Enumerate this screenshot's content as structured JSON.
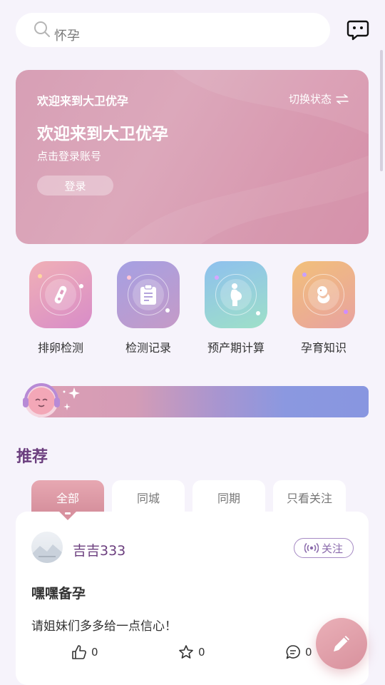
{
  "search": {
    "text": "怀孕",
    "icon": "search-icon"
  },
  "header": {
    "message_icon": "message-icon"
  },
  "banner": {
    "welcome_small": "欢迎来到大卫优孕",
    "switch_label": "切换状态",
    "switch_icon": "swap-icon",
    "welcome_big": "欢迎来到大卫优孕",
    "login_hint": "点击登录账号",
    "login_button": "登录"
  },
  "tools": [
    {
      "label": "排卵检测",
      "icon": "ovulation-test-icon",
      "color_from": "#f0b0b6",
      "color_to": "#d88cc8"
    },
    {
      "label": "检测记录",
      "icon": "clipboard-icon",
      "color_from": "#a5a0e3",
      "color_to": "#c59ac7"
    },
    {
      "label": "预产期计算",
      "icon": "pregnant-woman-icon",
      "color_from": "#8ec0ee",
      "color_to": "#9ee0c8"
    },
    {
      "label": "孕育知识",
      "icon": "fetus-icon",
      "color_from": "#f2c07a",
      "color_to": "#e8a2a0"
    }
  ],
  "recommend": {
    "title": "推荐",
    "tabs": [
      "全部",
      "同城",
      "同期",
      "只看关注"
    ],
    "active_tab": "全部"
  },
  "post": {
    "username": "吉吉333",
    "follow_label": "关注",
    "title": "嘿嘿备孕",
    "body": "请姐妹们多多给一点信心！",
    "likes": "0",
    "favorites": "0",
    "comments": "0"
  },
  "colors": {
    "accent": "#d8919d",
    "brand_purple": "#6b3e7e",
    "banner": "#d79fb5"
  }
}
